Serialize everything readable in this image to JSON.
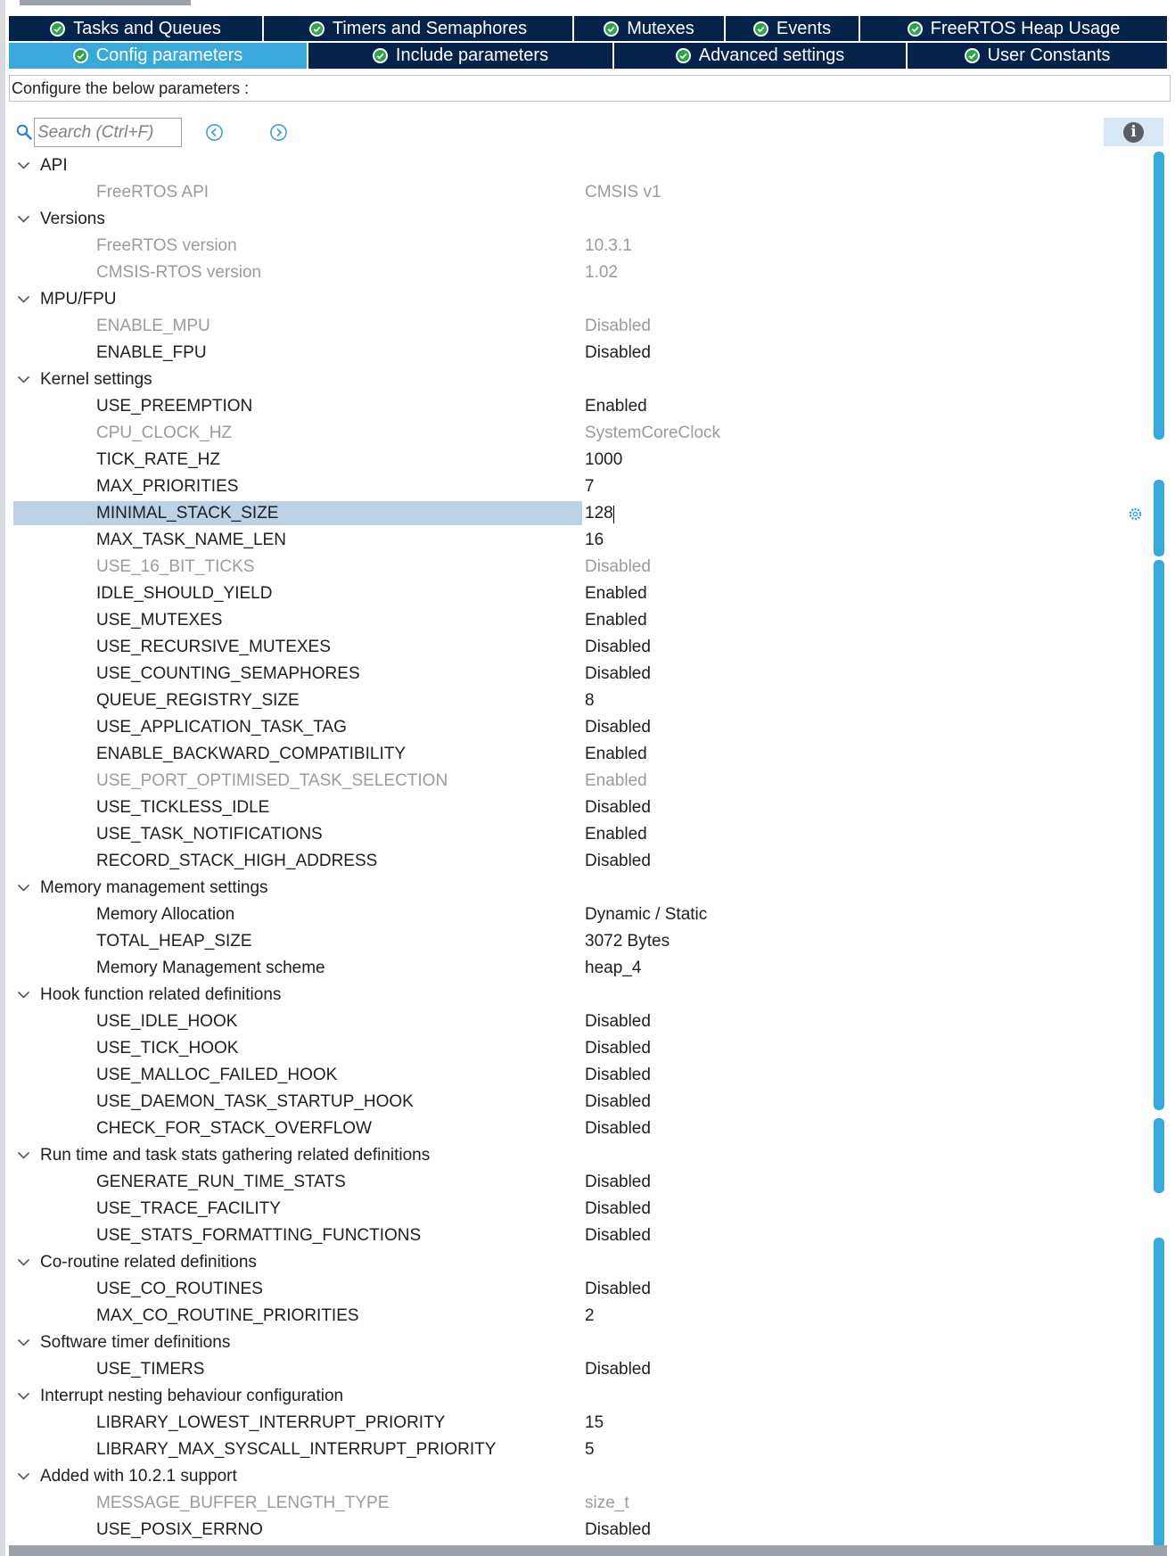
{
  "tabs_row1": [
    {
      "label": "Tasks and Queues",
      "width": 286
    },
    {
      "label": "Timers and Semaphores",
      "width": 348
    },
    {
      "label": "Mutexes",
      "width": 170
    },
    {
      "label": "Events",
      "width": 151
    },
    {
      "label": "FreeRTOS Heap Usage",
      "width": 344
    }
  ],
  "tabs_row2": [
    {
      "label": "Config parameters",
      "width": 336,
      "active": true
    },
    {
      "label": "Include parameters",
      "width": 343
    },
    {
      "label": "Advanced settings",
      "width": 329
    },
    {
      "label": "User Constants",
      "width": 291
    }
  ],
  "configure_text": "Configure the below parameters :",
  "search": {
    "placeholder": "Search (Ctrl+F)",
    "value": ""
  },
  "colors": {
    "tab_bg": "#03234b",
    "tab_active": "#39a9dc",
    "selection": "#bcd0e6",
    "dim_text": "#9b9b9b",
    "scrollbar": "#39a9dc"
  },
  "tree": [
    {
      "group": "API",
      "params": [
        {
          "name": "FreeRTOS API",
          "value": "CMSIS v1",
          "dim": true
        }
      ]
    },
    {
      "group": "Versions",
      "params": [
        {
          "name": "FreeRTOS version",
          "value": "10.3.1",
          "dim": true
        },
        {
          "name": "CMSIS-RTOS version",
          "value": "1.02",
          "dim": true
        }
      ]
    },
    {
      "group": "MPU/FPU",
      "params": [
        {
          "name": "ENABLE_MPU",
          "value": "Disabled",
          "dim": true
        },
        {
          "name": "ENABLE_FPU",
          "value": "Disabled"
        }
      ]
    },
    {
      "group": "Kernel settings",
      "params": [
        {
          "name": "USE_PREEMPTION",
          "value": "Enabled"
        },
        {
          "name": "CPU_CLOCK_HZ",
          "value": "SystemCoreClock",
          "dim": true
        },
        {
          "name": "TICK_RATE_HZ",
          "value": "1000"
        },
        {
          "name": "MAX_PRIORITIES",
          "value": "7"
        },
        {
          "name": "MINIMAL_STACK_SIZE",
          "value": "128",
          "selected": true
        },
        {
          "name": "MAX_TASK_NAME_LEN",
          "value": "16"
        },
        {
          "name": "USE_16_BIT_TICKS",
          "value": "Disabled",
          "dim": true
        },
        {
          "name": "IDLE_SHOULD_YIELD",
          "value": "Enabled"
        },
        {
          "name": "USE_MUTEXES",
          "value": "Enabled"
        },
        {
          "name": "USE_RECURSIVE_MUTEXES",
          "value": "Disabled"
        },
        {
          "name": "USE_COUNTING_SEMAPHORES",
          "value": "Disabled"
        },
        {
          "name": "QUEUE_REGISTRY_SIZE",
          "value": "8"
        },
        {
          "name": "USE_APPLICATION_TASK_TAG",
          "value": "Disabled"
        },
        {
          "name": "ENABLE_BACKWARD_COMPATIBILITY",
          "value": "Enabled"
        },
        {
          "name": "USE_PORT_OPTIMISED_TASK_SELECTION",
          "value": "Enabled",
          "dim": true
        },
        {
          "name": "USE_TICKLESS_IDLE",
          "value": "Disabled"
        },
        {
          "name": "USE_TASK_NOTIFICATIONS",
          "value": "Enabled"
        },
        {
          "name": "RECORD_STACK_HIGH_ADDRESS",
          "value": "Disabled"
        }
      ]
    },
    {
      "group": "Memory management settings",
      "params": [
        {
          "name": "Memory Allocation",
          "value": "Dynamic / Static"
        },
        {
          "name": "TOTAL_HEAP_SIZE",
          "value": "3072 Bytes"
        },
        {
          "name": "Memory Management scheme",
          "value": "heap_4"
        }
      ]
    },
    {
      "group": "Hook function related definitions",
      "params": [
        {
          "name": "USE_IDLE_HOOK",
          "value": "Disabled"
        },
        {
          "name": "USE_TICK_HOOK",
          "value": "Disabled"
        },
        {
          "name": "USE_MALLOC_FAILED_HOOK",
          "value": "Disabled"
        },
        {
          "name": "USE_DAEMON_TASK_STARTUP_HOOK",
          "value": "Disabled"
        },
        {
          "name": "CHECK_FOR_STACK_OVERFLOW",
          "value": "Disabled"
        }
      ]
    },
    {
      "group": "Run time and task stats gathering related definitions",
      "params": [
        {
          "name": "GENERATE_RUN_TIME_STATS",
          "value": "Disabled"
        },
        {
          "name": "USE_TRACE_FACILITY",
          "value": "Disabled"
        },
        {
          "name": "USE_STATS_FORMATTING_FUNCTIONS",
          "value": "Disabled"
        }
      ]
    },
    {
      "group": "Co-routine related definitions",
      "params": [
        {
          "name": "USE_CO_ROUTINES",
          "value": "Disabled"
        },
        {
          "name": "MAX_CO_ROUTINE_PRIORITIES",
          "value": "2"
        }
      ]
    },
    {
      "group": "Software timer definitions",
      "params": [
        {
          "name": "USE_TIMERS",
          "value": "Disabled"
        }
      ]
    },
    {
      "group": "Interrupt nesting behaviour configuration",
      "params": [
        {
          "name": "LIBRARY_LOWEST_INTERRUPT_PRIORITY",
          "value": "15"
        },
        {
          "name": "LIBRARY_MAX_SYSCALL_INTERRUPT_PRIORITY",
          "value": "5"
        }
      ]
    },
    {
      "group": "Added with 10.2.1 support",
      "params": [
        {
          "name": "MESSAGE_BUFFER_LENGTH_TYPE",
          "value": "size_t",
          "dim": true
        },
        {
          "name": "USE_POSIX_ERRNO",
          "value": "Disabled"
        }
      ]
    }
  ]
}
